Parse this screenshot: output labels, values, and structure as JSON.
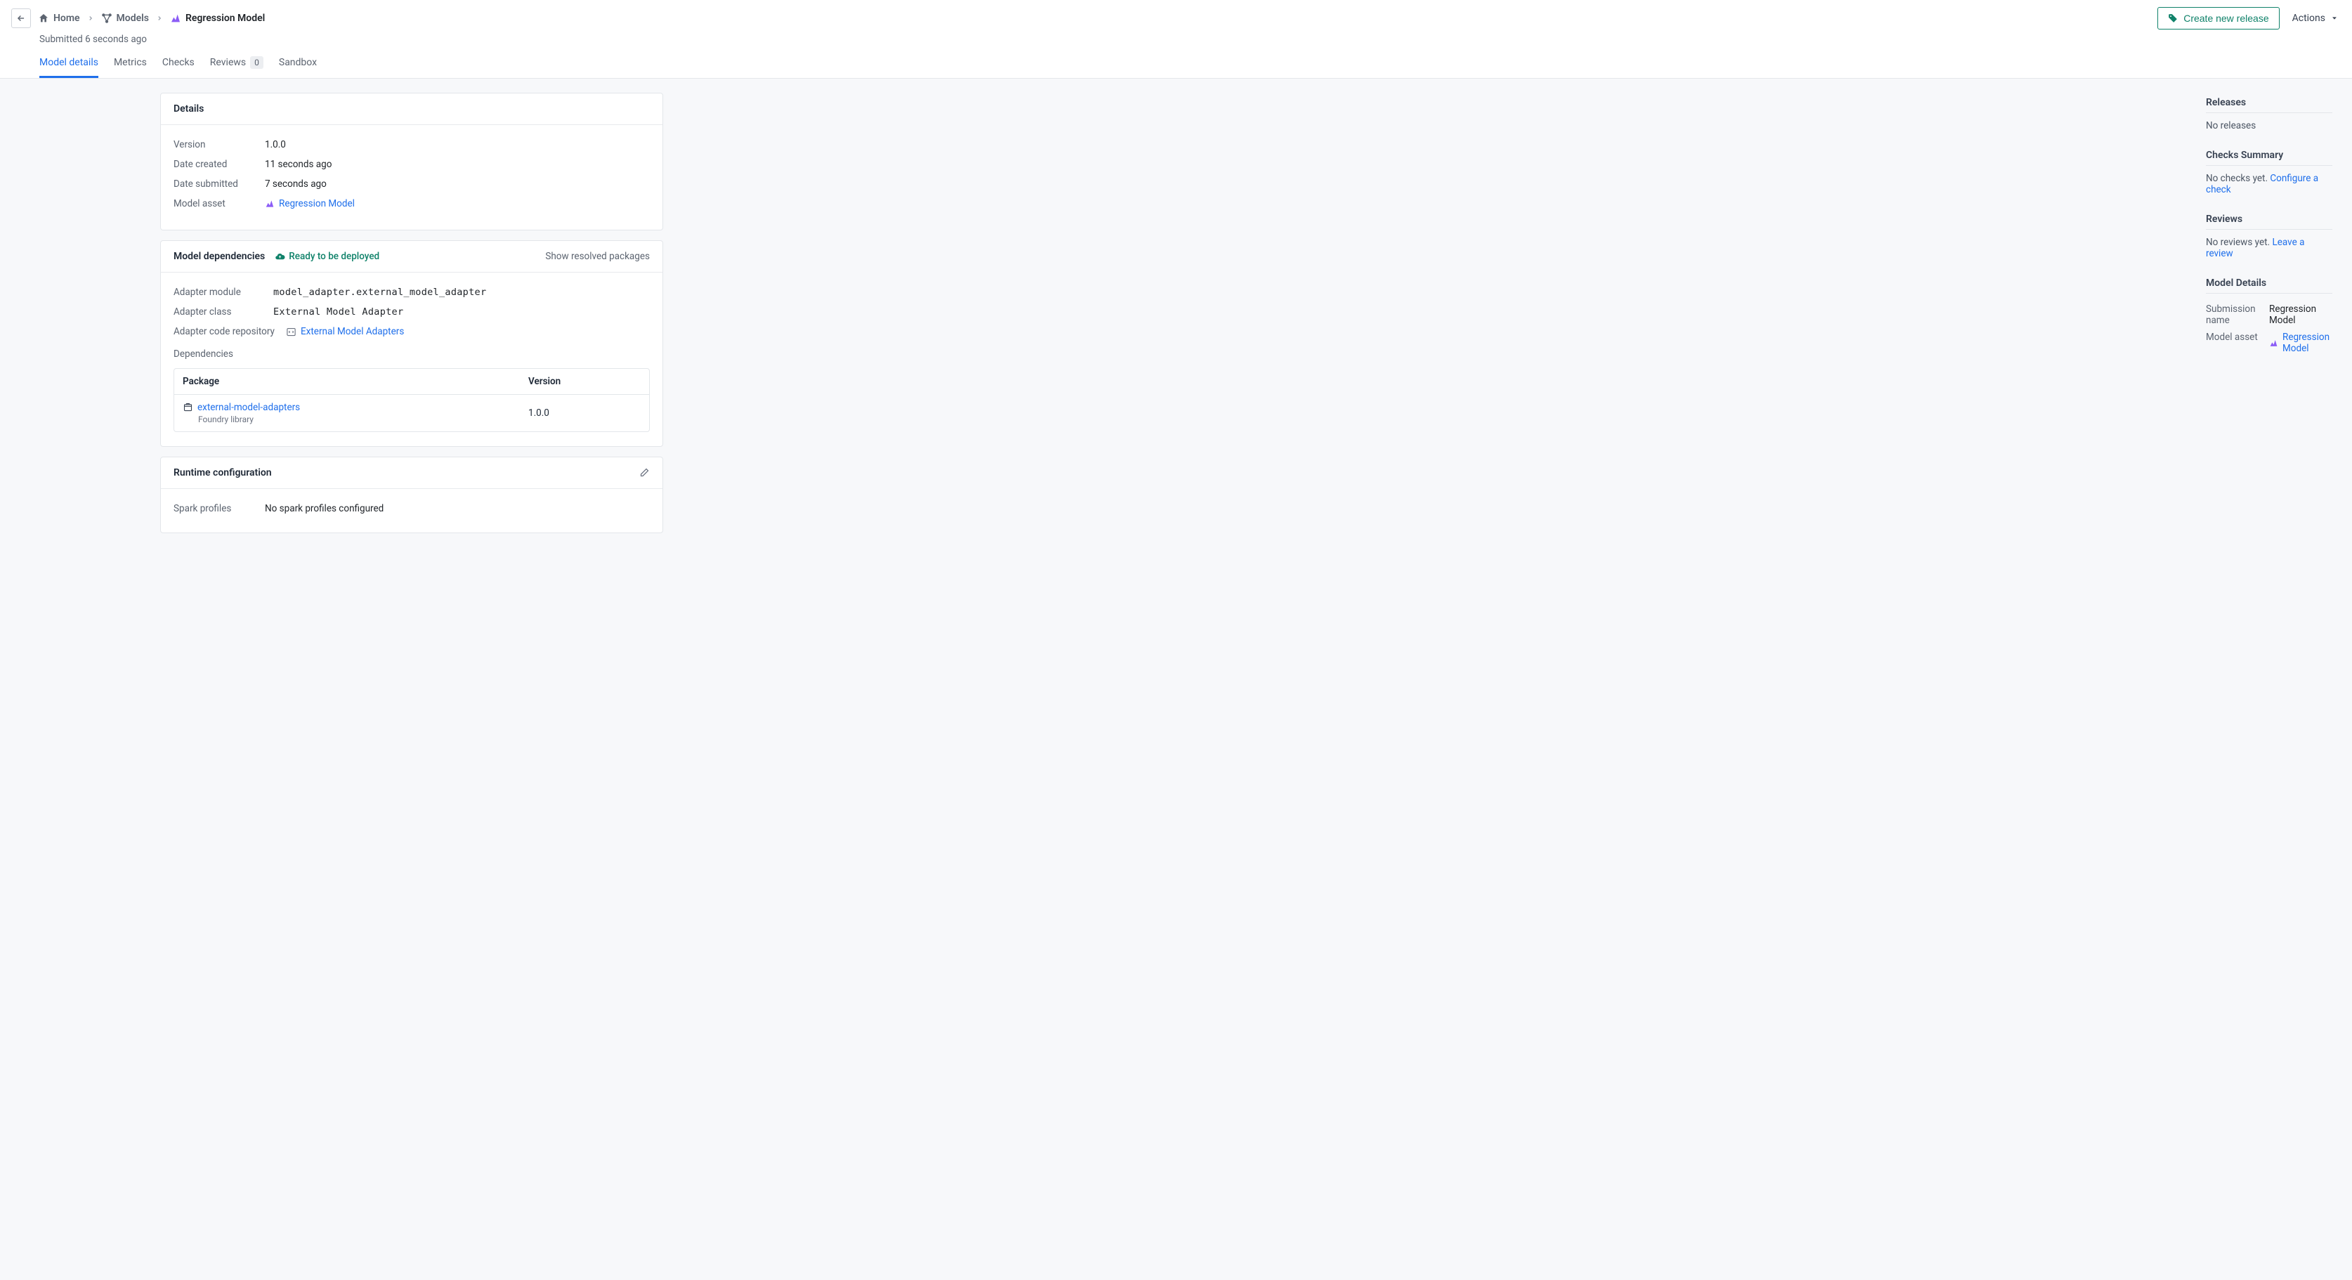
{
  "breadcrumbs": {
    "home": "Home",
    "models": "Models",
    "current": "Regression Model"
  },
  "submitted_line": "Submitted 6 seconds ago",
  "header_buttons": {
    "create_release": "Create new release",
    "actions": "Actions"
  },
  "tabs": {
    "model_details": "Model details",
    "metrics": "Metrics",
    "checks": "Checks",
    "reviews": "Reviews",
    "reviews_count": "0",
    "sandbox": "Sandbox"
  },
  "details_card": {
    "title": "Details",
    "rows": {
      "version_label": "Version",
      "version_value": "1.0.0",
      "date_created_label": "Date created",
      "date_created_value": "11 seconds ago",
      "date_submitted_label": "Date submitted",
      "date_submitted_value": "7 seconds ago",
      "model_asset_label": "Model asset",
      "model_asset_value": "Regression Model"
    }
  },
  "deps_card": {
    "title": "Model dependencies",
    "ready_text": "Ready to be deployed",
    "show_resolved": "Show resolved packages",
    "rows": {
      "adapter_module_label": "Adapter module",
      "adapter_module_value": "model_adapter.external_model_adapter",
      "adapter_class_label": "Adapter class",
      "adapter_class_value": "External Model Adapter",
      "adapter_repo_label": "Adapter code repository",
      "adapter_repo_value": "External Model Adapters",
      "dependencies_label": "Dependencies"
    },
    "table": {
      "head_package": "Package",
      "head_version": "Version",
      "package_name": "external-model-adapters",
      "package_sub": "Foundry library",
      "package_version": "1.0.0"
    }
  },
  "runtime_card": {
    "title": "Runtime configuration",
    "spark_label": "Spark profiles",
    "spark_value": "No spark profiles configured"
  },
  "sidebar": {
    "releases_title": "Releases",
    "releases_text": "No releases",
    "checks_title": "Checks Summary",
    "checks_text": "No checks yet. ",
    "checks_link": "Configure a check",
    "reviews_title": "Reviews",
    "reviews_text": "No reviews yet. ",
    "reviews_link": "Leave a review",
    "model_details_title": "Model Details",
    "submission_name_label": "Submission name",
    "submission_name_value": "Regression Model",
    "model_asset_label": "Model asset",
    "model_asset_value": "Regression Model"
  }
}
